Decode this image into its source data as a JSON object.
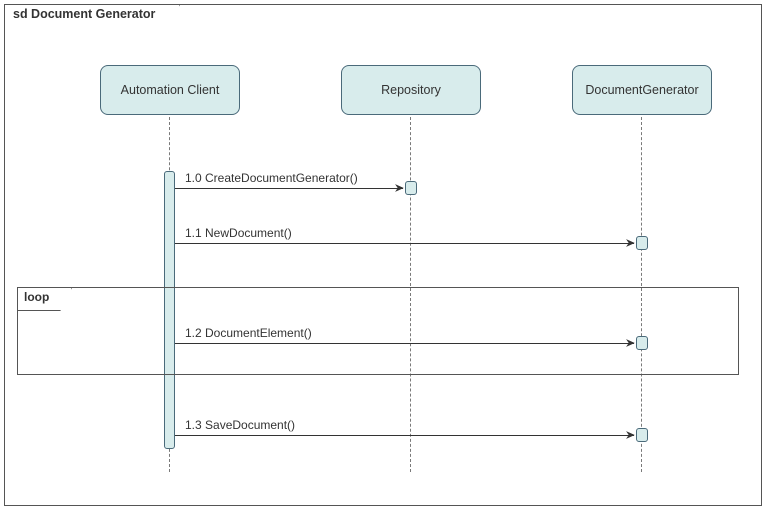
{
  "frame": {
    "title": "sd Document Generator"
  },
  "lifelines": [
    {
      "name": "Automation Client"
    },
    {
      "name": "Repository"
    },
    {
      "name": "DocumentGenerator"
    }
  ],
  "messages": [
    {
      "seq": "1.0",
      "label": "1.0 CreateDocumentGenerator()",
      "from": 0,
      "to": 1
    },
    {
      "seq": "1.1",
      "label": "1.1 NewDocument()",
      "from": 0,
      "to": 2
    },
    {
      "seq": "1.2",
      "label": "1.2 DocumentElement()",
      "from": 0,
      "to": 2
    },
    {
      "seq": "1.3",
      "label": "1.3 SaveDocument()",
      "from": 0,
      "to": 2
    }
  ],
  "fragments": [
    {
      "kind": "loop",
      "label": "loop",
      "covers_messages": [
        "1.2"
      ]
    }
  ]
}
